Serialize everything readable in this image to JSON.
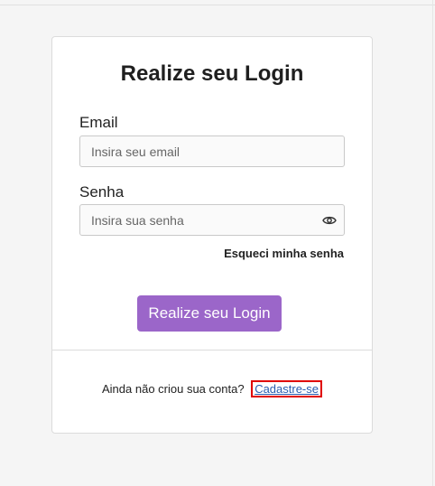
{
  "login": {
    "title": "Realize seu Login",
    "email_label": "Email",
    "email_placeholder": "Insira seu email",
    "password_label": "Senha",
    "password_placeholder": "Insira sua senha",
    "forgot_password": "Esqueci minha senha",
    "submit_label": "Realize seu Login",
    "no_account_text": "Ainda não criou sua conta?",
    "signup_link": "Cadastre-se"
  },
  "colors": {
    "accent": "#9b66c9",
    "link": "#2a5db0",
    "highlight": "#e00000"
  },
  "icons": {
    "password_toggle": "eye-icon"
  }
}
